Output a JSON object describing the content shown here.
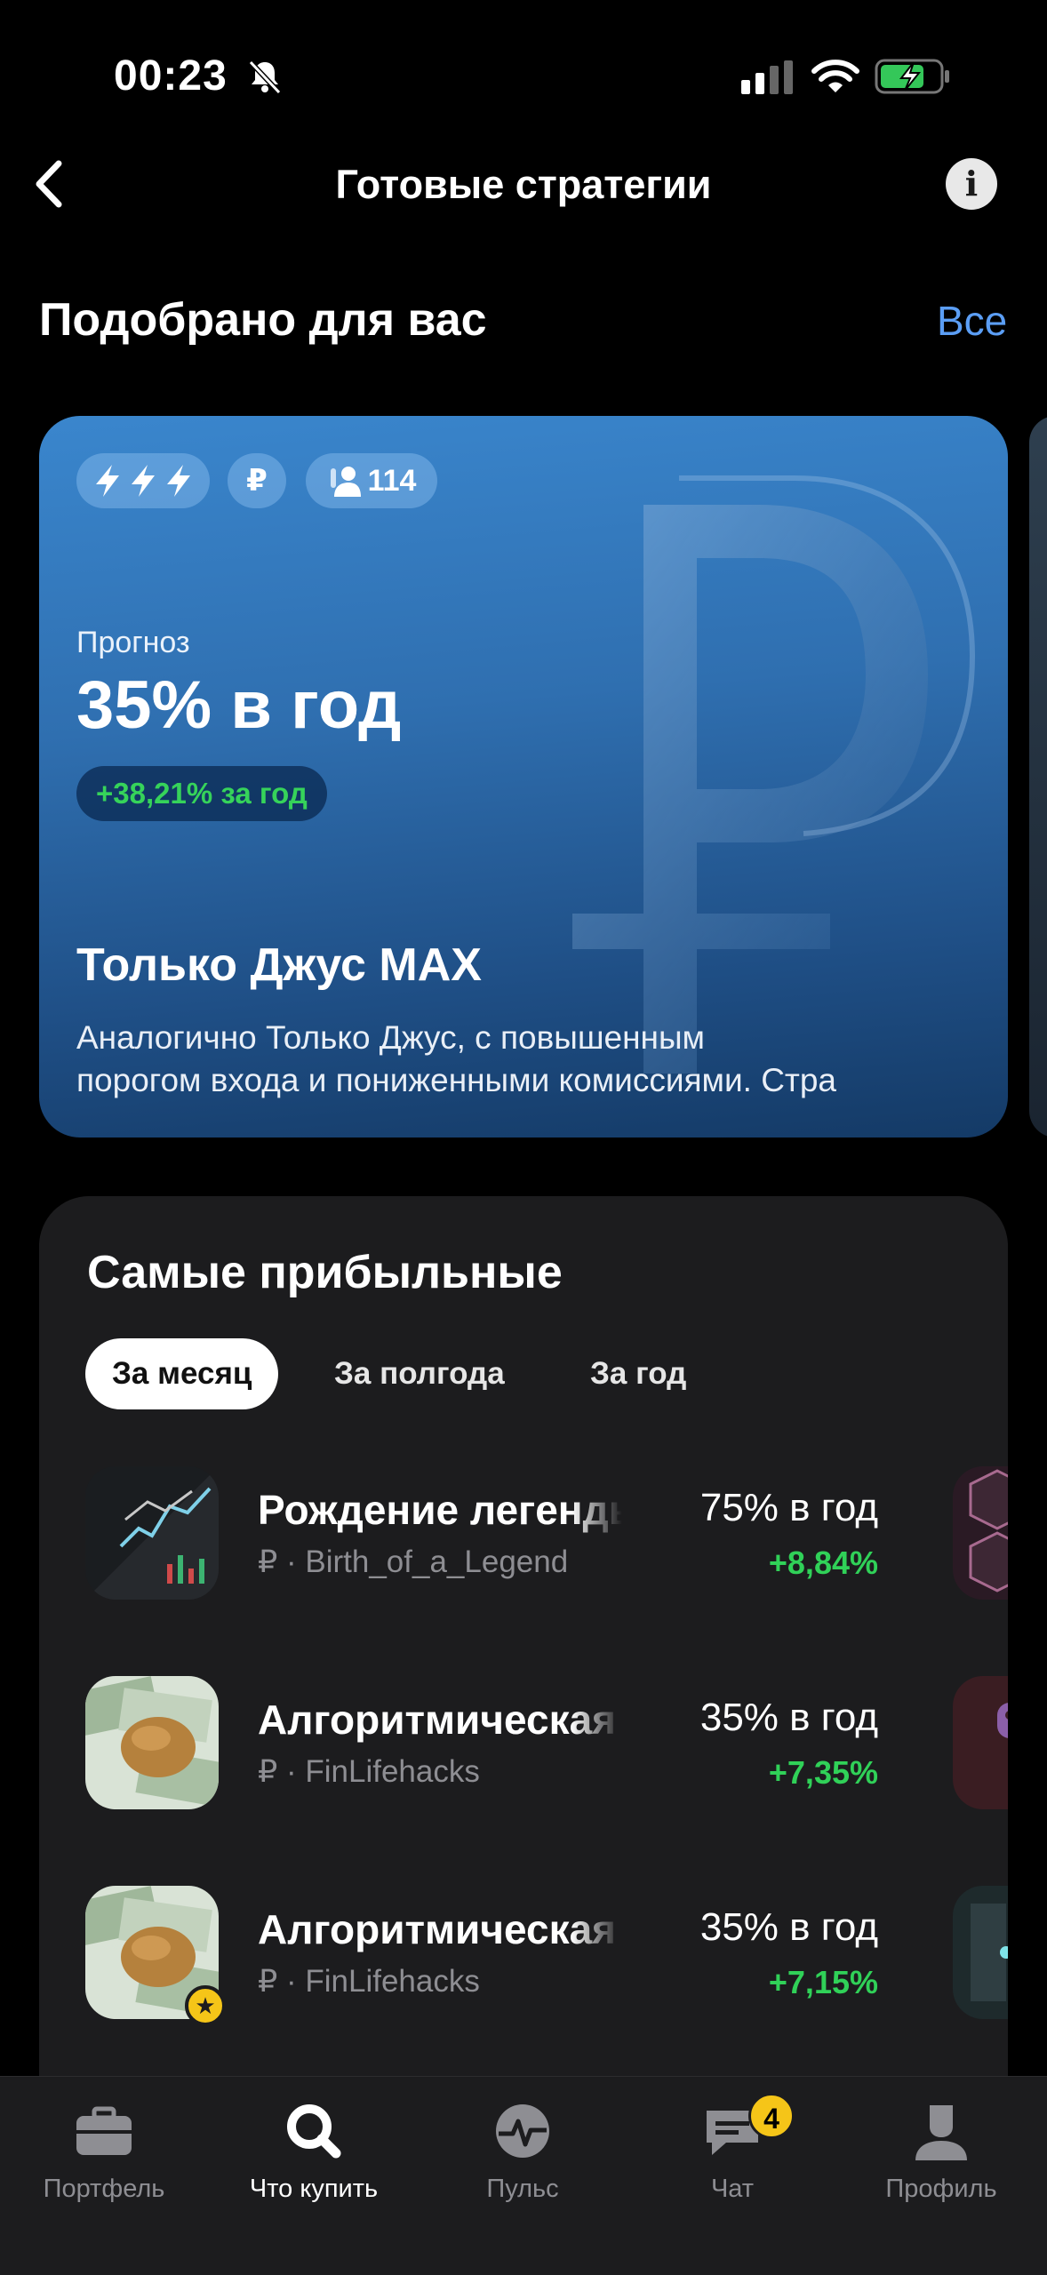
{
  "status_bar": {
    "time": "00:23"
  },
  "header": {
    "title": "Готовые стратегии",
    "info_icon": "i"
  },
  "recommended": {
    "title": "Подобрано для вас",
    "see_all": "Все",
    "card": {
      "risk_icon": "bolt-icon",
      "currency": "₽",
      "subscribers": "114",
      "forecast_label": "Прогноз",
      "forecast_value": "35% в год",
      "yield_pill": "+38,21% за год",
      "title": "Только Джус MAX",
      "description_line1": "Аналогично Только Джус, с повышенным",
      "description_line2": "порогом входа и пониженными комиссиями. Стра"
    }
  },
  "most_profitable": {
    "title": "Самые прибыльные",
    "tabs": [
      {
        "label": "За месяц",
        "active": true
      },
      {
        "label": "За полгода",
        "active": false
      },
      {
        "label": "За год",
        "active": false
      }
    ],
    "rows": [
      {
        "name": "Рождение легенды",
        "sub": "₽ · Birth_of_a_Legend",
        "forecast": "75% в год",
        "change": "+8,84%"
      },
      {
        "name": "Алгоритмическая",
        "sub": "₽ · FinLifehacks",
        "forecast": "35% в год",
        "change": "+7,35%"
      },
      {
        "name": "Алгоритмическая",
        "sub": "₽ · FinLifehacks",
        "forecast": "35% в год",
        "change": "+7,15%",
        "badge": "★"
      }
    ]
  },
  "tab_bar": {
    "items": [
      {
        "label": "Портфель",
        "icon": "briefcase-icon",
        "active": false
      },
      {
        "label": "Что купить",
        "icon": "search-icon",
        "active": true
      },
      {
        "label": "Пульс",
        "icon": "pulse-icon",
        "active": false
      },
      {
        "label": "Чат",
        "icon": "chat-icon",
        "active": false,
        "badge": "4"
      },
      {
        "label": "Профиль",
        "icon": "profile-icon",
        "active": false
      }
    ]
  },
  "colors": {
    "accent": "#5b9ef5",
    "positive": "#30d158",
    "badge": "#f5c518",
    "card_blue": "#2f6fb0"
  }
}
